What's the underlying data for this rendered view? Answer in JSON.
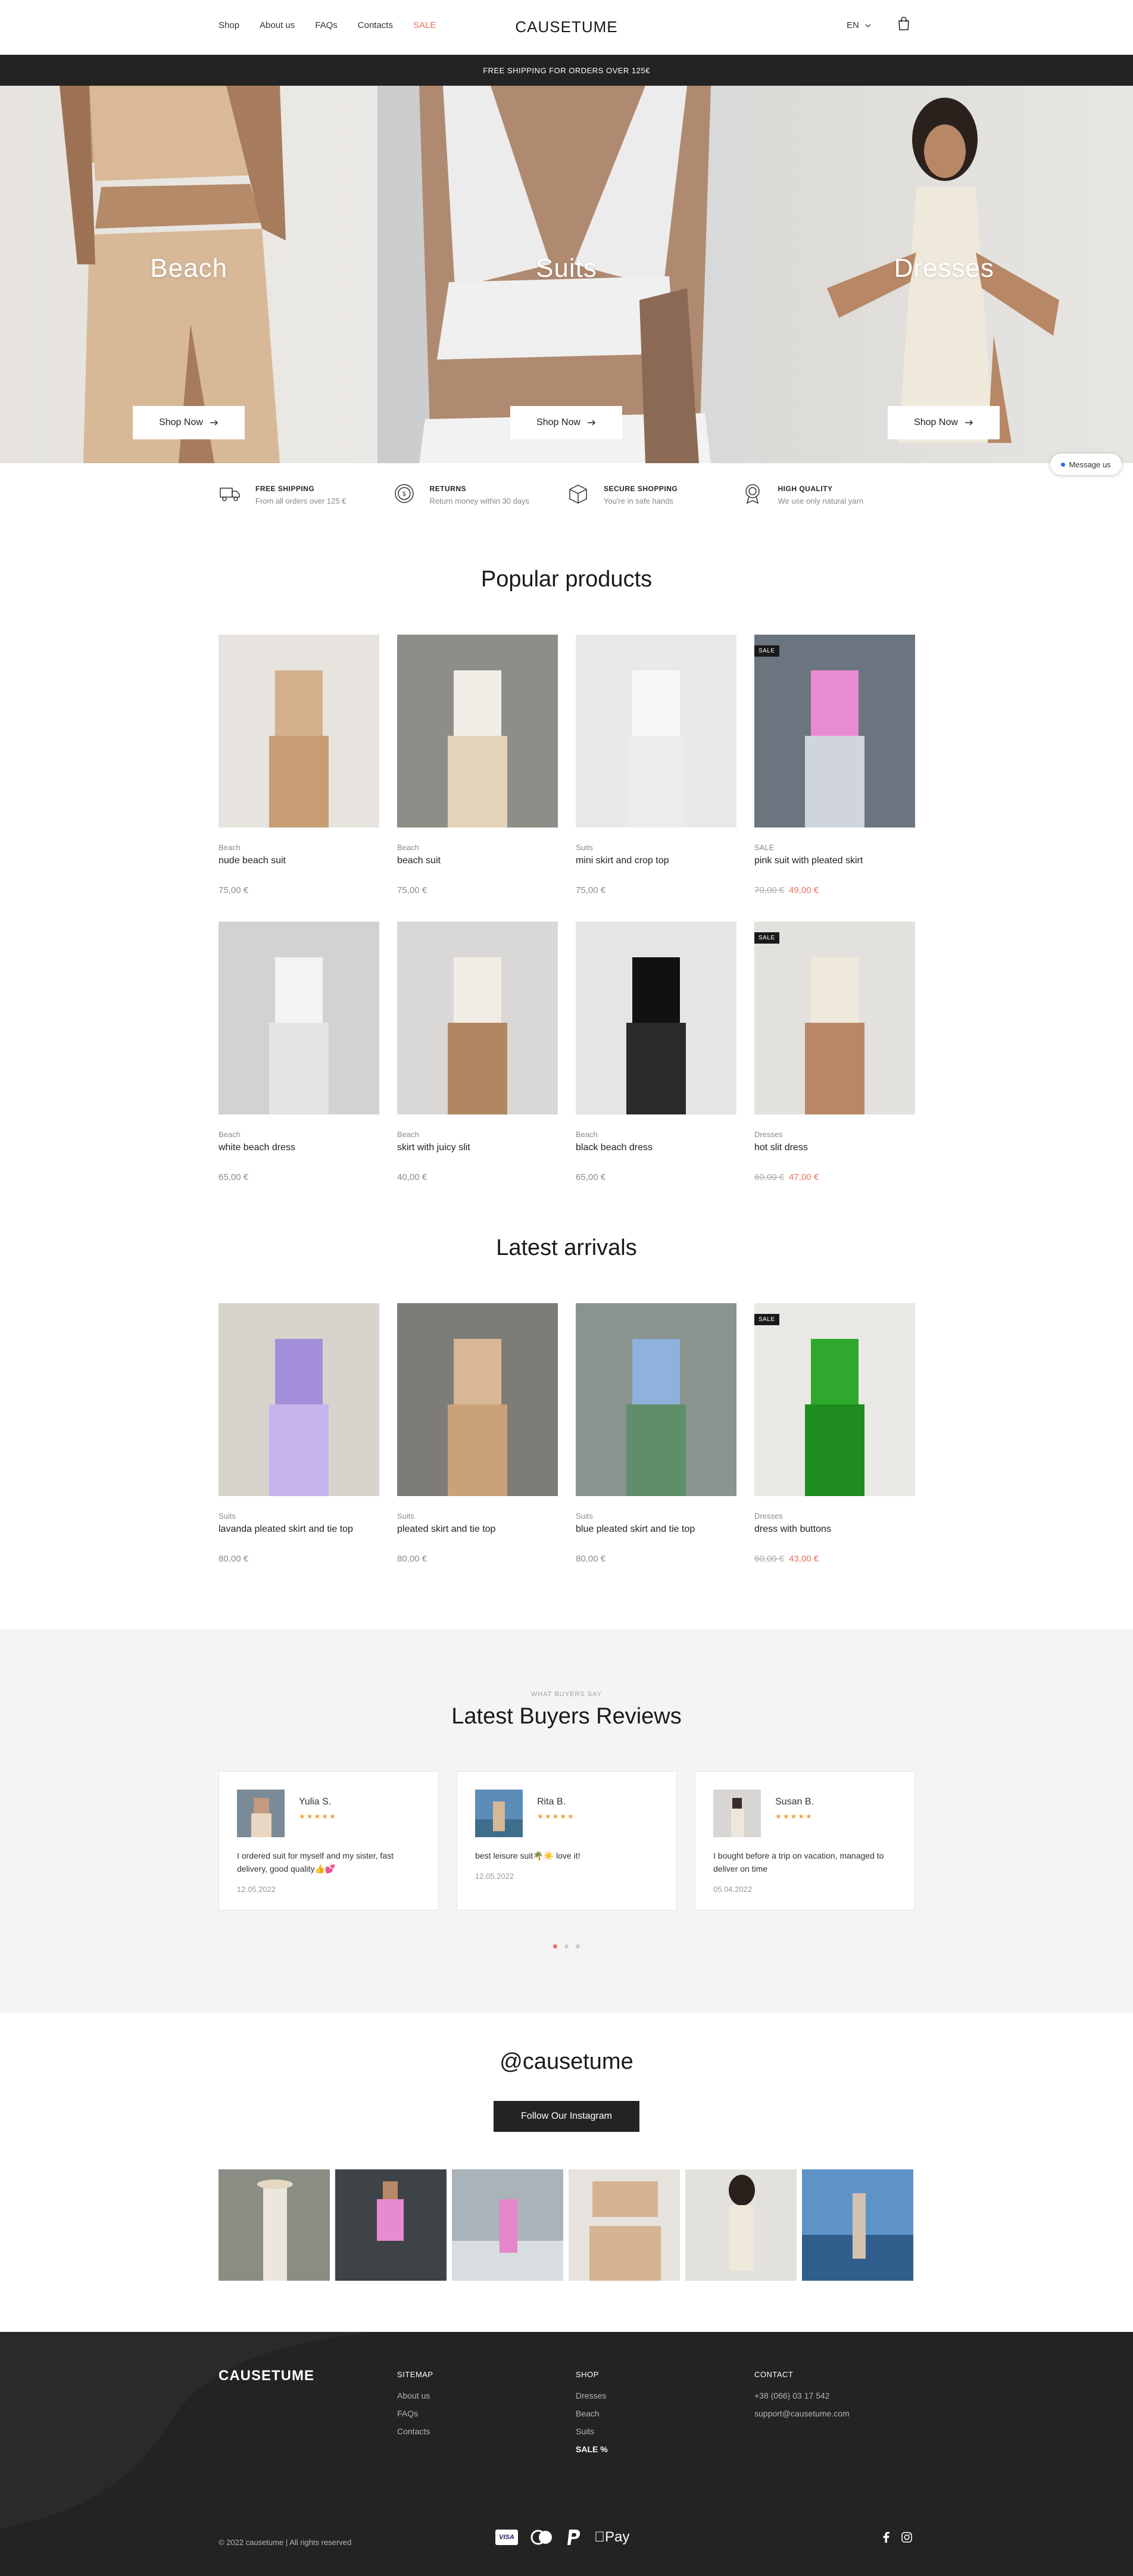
{
  "header": {
    "nav": [
      "Shop",
      "About us",
      "FAQs",
      "Contacts",
      "SALE"
    ],
    "logo": "CAUSETUME",
    "language": "EN"
  },
  "announcement": "FREE SHIPPING FOR ORDERS OVER 125€",
  "hero": [
    {
      "title": "Beach",
      "button": "Shop Now"
    },
    {
      "title": "Suits",
      "button": "Shop Now"
    },
    {
      "title": "Dresses",
      "button": "Shop Now"
    }
  ],
  "message_button": "Message us",
  "features": [
    {
      "icon": "truck-icon",
      "title": "FREE SHIPPING",
      "desc": "From all orders over 125 €"
    },
    {
      "icon": "returns-coin-icon",
      "title": "RETURNS",
      "desc": "Return money within 30 days"
    },
    {
      "icon": "box-icon",
      "title": "SECURE SHOPPING",
      "desc": "You're in safe hands"
    },
    {
      "icon": "medal-icon",
      "title": "HIGH QUALITY",
      "desc": "We use only natural yarn"
    }
  ],
  "popular_title": "Popular products",
  "popular": [
    {
      "cat": "Beach",
      "name": "nude beach suit",
      "price": "75,00 €"
    },
    {
      "cat": "Beach",
      "name": "beach suit",
      "price": "75,00 €"
    },
    {
      "cat": "Suits",
      "name": "mini skirt and crop top",
      "price": "75,00 €"
    },
    {
      "cat": "SALE",
      "name": "pink suit with pleated skirt",
      "old_price": "70,00 €",
      "price": "49,00 €",
      "badge": "SALE"
    },
    {
      "cat": "Beach",
      "name": "white beach dress",
      "price": "65,00 €"
    },
    {
      "cat": "Beach",
      "name": "skirt with juicy slit",
      "price": "40,00 €"
    },
    {
      "cat": "Beach",
      "name": "black beach dress",
      "price": "65,00 €"
    },
    {
      "cat": "Dresses",
      "name": "hot slit dress",
      "old_price": "60,00 €",
      "price": "47,00 €",
      "badge": "SALE"
    }
  ],
  "latest_title": "Latest arrivals",
  "latest": [
    {
      "cat": "Suits",
      "name": "lavanda pleated skirt and tie top",
      "price": "80,00 €"
    },
    {
      "cat": "Suits",
      "name": "pleated skirt and tie top",
      "price": "80,00 €"
    },
    {
      "cat": "Suits",
      "name": "blue pleated skirt and tie top",
      "price": "80,00 €"
    },
    {
      "cat": "Dresses",
      "name": "dress with buttons",
      "old_price": "60,00 €",
      "price": "43,00 €",
      "badge": "SALE"
    }
  ],
  "reviews_eyebrow": "WHAT BUYERS SAY",
  "reviews_title": "Latest Buyers Reviews",
  "reviews": [
    {
      "name": "Yulia S.",
      "stars": "★★★★★",
      "text": "I ordered suit for myself and my sister, fast delivery, good quality👍💕",
      "date": "12.05.2022"
    },
    {
      "name": "Rita B.",
      "stars": "★★★★★",
      "text": "best leisure suit🌴☀️ love it!",
      "date": "12.05.2022"
    },
    {
      "name": "Susan B.",
      "stars": "★★★★★",
      "text": "I bought before a trip on vacation, managed to deliver on time",
      "date": "05.04.2022"
    }
  ],
  "instagram": {
    "handle": "@causetume",
    "button": "Follow Our Instagram"
  },
  "footer": {
    "logo": "CAUSETUME",
    "sitemap_title": "SITEMAP",
    "sitemap": [
      "About us",
      "FAQs",
      "Contacts"
    ],
    "shop_title": "SHOP",
    "shop": [
      "Dresses",
      "Beach",
      "Suits",
      "SALE %"
    ],
    "contact_title": "CONTACT",
    "phone": "+38 (066) 03 17 542",
    "email": "support@causetume.com",
    "copyright": "© 2022 causetume | All rights reserved",
    "visa": "VISA",
    "apple_pay": "Pay"
  },
  "colors": {
    "accent": "#e8735a",
    "dark": "#232323",
    "star": "#f0a13a"
  }
}
